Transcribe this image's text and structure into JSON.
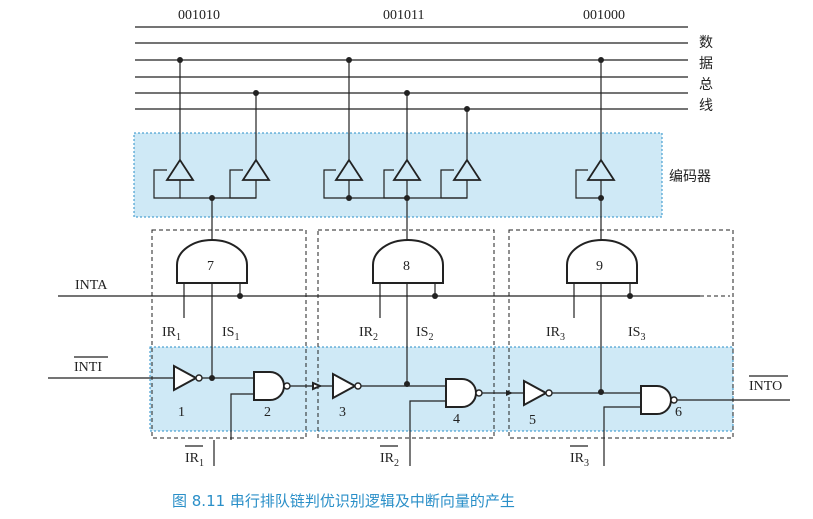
{
  "codes": [
    "001010",
    "001011",
    "001000"
  ],
  "bus_label_chars": [
    "数",
    "据",
    "总",
    "线"
  ],
  "encoder_label": "编码器",
  "and_gates": [
    "7",
    "8",
    "9"
  ],
  "inta_label": "INTA",
  "inti_label": "INTI",
  "into_label": "INTO",
  "stages": [
    {
      "ir": "IR",
      "is": "IS",
      "sub": "1",
      "ir_bar": "IR",
      "inv": "1",
      "nand": "2"
    },
    {
      "ir": "IR",
      "is": "IS",
      "sub": "2",
      "ir_bar": "IR",
      "inv": "3",
      "nand": "4"
    },
    {
      "ir": "IR",
      "is": "IS",
      "sub": "3",
      "ir_bar": "IR",
      "inv": "5",
      "nand": "6"
    }
  ],
  "caption": "图 8.11    串行排队链判优识别逻辑及中断向量的产生",
  "colors": {
    "panel": "#cfe9f6",
    "panel_border": "#2a8fc8",
    "caption": "#2a8fc8"
  }
}
